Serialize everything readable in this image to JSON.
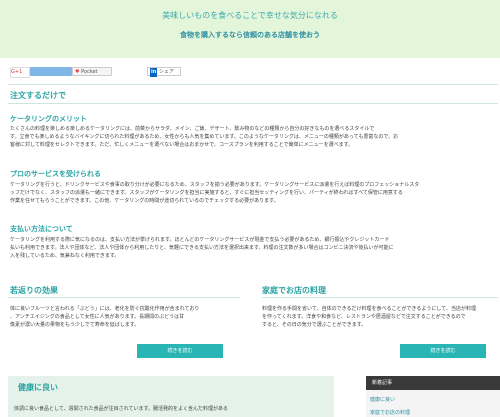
{
  "header": {
    "title": "美味しいものを食べることで幸せな気分になれる",
    "subtitle": "食物を購入するなら信頼のある店舗を使おう"
  },
  "share": {
    "google": "G+1",
    "pocket": "Pocket",
    "linkedin_mark": "in",
    "linkedin": "シェア"
  },
  "main": {
    "heading": "注文するだけで",
    "sections": [
      {
        "title": "ケータリングのメリット",
        "lines": [
          "たくさんの料理を楽しめる楽しめるケータリングには、前菜からサラダ、メイン、ご飯、デザート、飲み物のなどの種類から自分の好きなものを選べるスタイルで",
          "す。立食でも楽しめるようなバイキングに切られた料理があるため、女性からも人気を集めています。このようなケータリングは、メニューの種類があっても豊富なので、お",
          "客様に対して料理をセレクトできます。ただ、忙しくメニューを選べない場合はおまかせで、コースプランを利用することで簡単にメニューを選べます。"
        ]
      },
      {
        "title": "プロのサービスを受けられる",
        "lines": [
          "ケータリングを行うと、ドリンクサービスや食事の取り分けが必要になるため、スタッフを揃う必要があります。ケータリングサービスに派遣を行えば料理のプロフェッショナルスタ",
          "ッフだけでなく、スタッフの派遣も一緒にできます。スタッフがケータリングを担当に実施すると、すぐに担当セッティングを行い、パーティが終わればすべて保管に用意する",
          "作業を任せてもらうことができます。この他、ケータリングの時間が途切られているのでチェックする必要があります。"
        ]
      },
      {
        "title": "支払い方法について",
        "lines": [
          "ケータリングを利用する際に気になるのは、支払い方法が挙げられます。ほとんどのケータリングサービスが現金で支払う必要があるため、銀行振込やクレジットカード",
          "払いも利用できます。法人や団体など、法人や団体から利用したりと、気軽にできる支払い方法を選択出来ます。料理の注文数が多い場合はコンビニ決済や後払いが可能に",
          "入を残しているため、気兼ねなく利用できます。"
        ]
      }
    ]
  },
  "columns": [
    {
      "title": "若返りの効果",
      "lines": [
        "体に良いフルーツと言われる「ぶどう」には、老化を防ぐ抗酸化作用が含まれており",
        "、アンチエイジングの食品として女性に人気があります。長期間のぶどうは甘",
        "像素が濃い大量の果物をもう少しでて寿命を延ばします。"
      ],
      "button": "続きを読む"
    },
    {
      "title": "家庭でお店の料理",
      "lines": [
        "料理を作る手間を省いて、自体のできるだけ料理を食べることができるようにして、当店が料理",
        "を作ってくれます。洋食や和食など、レストランや居酒屋などで注文することができるので",
        "すると、その日の気分で選ぶことができます。"
      ],
      "button": "続きを読む"
    }
  ],
  "health": {
    "title": "健康に良い",
    "text": "体調に良い食品として、週間された食品が注目されています。腸活発的をよく含んだ料理がある"
  },
  "sidebar": {
    "heading": "新着記事",
    "links": [
      "健康に良い",
      "家庭でお店の料理"
    ]
  }
}
